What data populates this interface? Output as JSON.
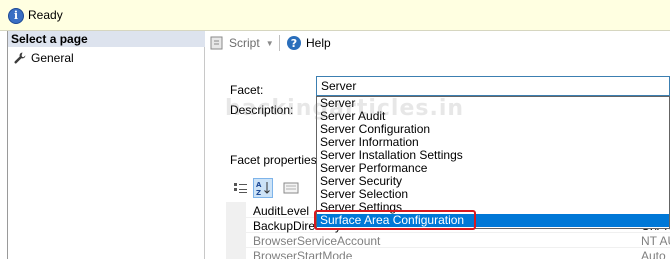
{
  "status_bar": {
    "text": "Ready",
    "icon": "info-icon"
  },
  "left_pane": {
    "header": "Select a page",
    "items": [
      {
        "label": "General",
        "icon": "wrench-icon"
      }
    ]
  },
  "toolbar": {
    "script_label": "Script",
    "help_label": "Help"
  },
  "form": {
    "facet_label": "Facet:",
    "facet_value": "Server",
    "description_label": "Description:",
    "facet_properties_label": "Facet properties:"
  },
  "facet_dropdown": {
    "items": [
      "Server",
      "Server Audit",
      "Server Configuration",
      "Server Information",
      "Server Installation Settings",
      "Server Performance",
      "Server Security",
      "Server Selection",
      "Server Settings",
      "Surface Area Configuration"
    ],
    "selected_index": 9
  },
  "properties": [
    {
      "name": "AuditLevel",
      "value": "",
      "dim": false
    },
    {
      "name": "BackupDirectory",
      "value": "C:\\Pro",
      "dim": false
    },
    {
      "name": "BrowserServiceAccount",
      "value": "NT AU",
      "dim": true
    },
    {
      "name": "BrowserStartMode",
      "value": "Auto",
      "dim": true
    }
  ],
  "watermark": "hackingarticles.in",
  "colors": {
    "status_bg": "#ffffe1",
    "selection": "#0078d7",
    "highlight": "#d71920"
  }
}
